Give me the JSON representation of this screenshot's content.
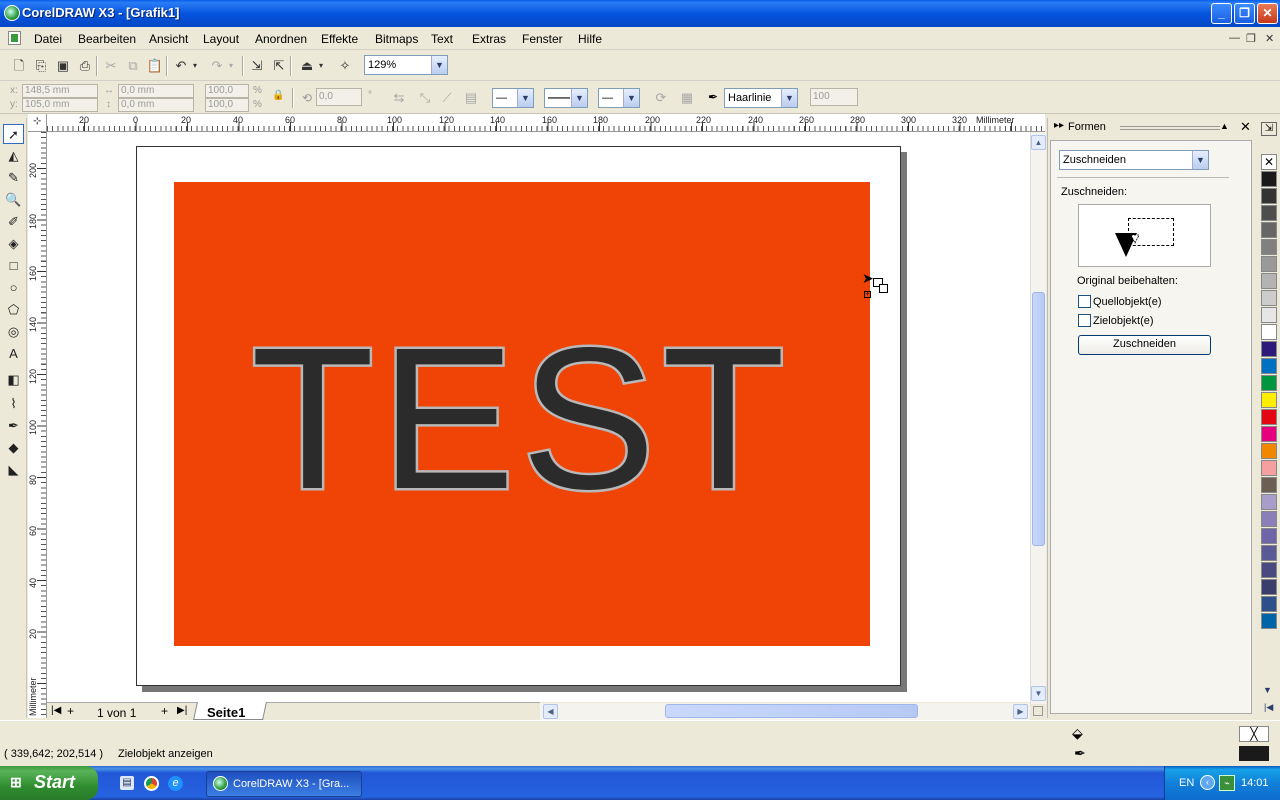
{
  "window": {
    "title": "CorelDRAW X3 - [Grafik1]"
  },
  "menu": [
    "Datei",
    "Bearbeiten",
    "Ansicht",
    "Layout",
    "Anordnen",
    "Effekte",
    "Bitmaps",
    "Text",
    "Extras",
    "Fenster",
    "Hilfe"
  ],
  "toolbar": {
    "zoom": "129%"
  },
  "property_bar": {
    "x": "148,5 mm",
    "y": "105,0 mm",
    "w": "0,0 mm",
    "h": "0,0 mm",
    "scale_x": "100,0",
    "scale_y": "100,0",
    "percent": "%",
    "rotation": "0,0",
    "degree": "°",
    "outline_width": "Haarlinie",
    "opacity": "100"
  },
  "rulers": {
    "unit": "Millimeter",
    "h_labels": [
      "20",
      "0",
      "20",
      "40",
      "60",
      "80",
      "100",
      "120",
      "140",
      "160",
      "180",
      "200",
      "220",
      "240",
      "260",
      "280",
      "300",
      "320"
    ],
    "v_labels": [
      "200",
      "180",
      "160",
      "140",
      "120",
      "100",
      "80",
      "60",
      "40",
      "20"
    ]
  },
  "canvas": {
    "text": "TEST",
    "rect_color": "#ef4405",
    "text_fill": "#2b2b2b",
    "text_outline": "#b8b8b8"
  },
  "page_tabs": {
    "counter": "1 von 1",
    "page_name": "Seite1"
  },
  "docker": {
    "title": "Formen",
    "mode": "Zuschneiden",
    "section_label": "Zuschneiden:",
    "keep_original": "Original beibehalten:",
    "checkbox_source": "Quellobjekt(e)",
    "checkbox_target": "Zielobjekt(e)",
    "apply_button": "Zuschneiden"
  },
  "palette_colors": [
    "#1a1a1a",
    "#333333",
    "#4d4d4d",
    "#666666",
    "#808080",
    "#999999",
    "#b3b3b3",
    "#cccccc",
    "#e6e6e6",
    "#ffffff",
    "#2e1a78",
    "#0070c0",
    "#009640",
    "#ffed00",
    "#e30613",
    "#e6007e",
    "#f18700",
    "#f4a0a0",
    "#6b5e52",
    "#a89cc8",
    "#8b7fb8",
    "#6e66a8",
    "#5a5a96",
    "#4a4a80",
    "#3b3e6a",
    "#2d4f8a",
    "#0064a8"
  ],
  "status": {
    "coords": "( 339,642; 202,514 )",
    "message": "Zielobjekt anzeigen"
  },
  "taskbar": {
    "start": "Start",
    "task": "CorelDRAW X3 - [Gra...",
    "lang": "EN",
    "time": "14:01"
  }
}
